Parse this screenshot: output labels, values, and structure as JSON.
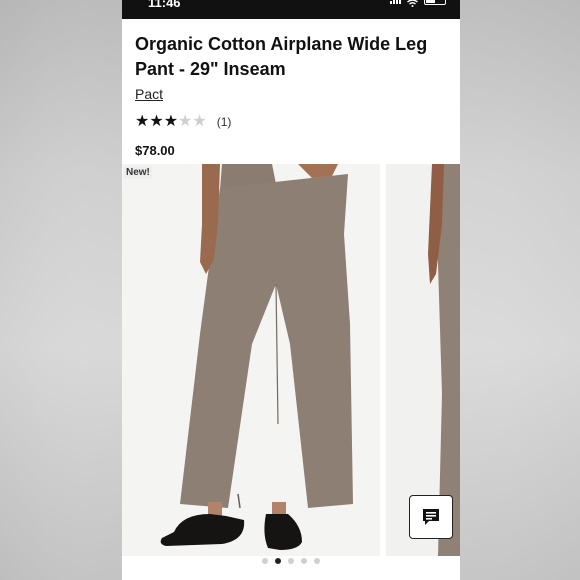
{
  "status_bar": {
    "time": "11:46"
  },
  "product": {
    "title": "Organic Cotton Airplane Wide Leg Pant - 29\" Inseam",
    "brand": "Pact",
    "rating": 3,
    "rating_max": 5,
    "review_count": "(1)",
    "price": "$78.00"
  },
  "gallery": {
    "badge": "New!",
    "image_count": 5,
    "active_index": 1
  },
  "icons": {
    "chat": "chat-bubble-icon",
    "star": "star-icon"
  },
  "colors": {
    "pant": "#8b7d70",
    "status_bar": "#111111"
  }
}
